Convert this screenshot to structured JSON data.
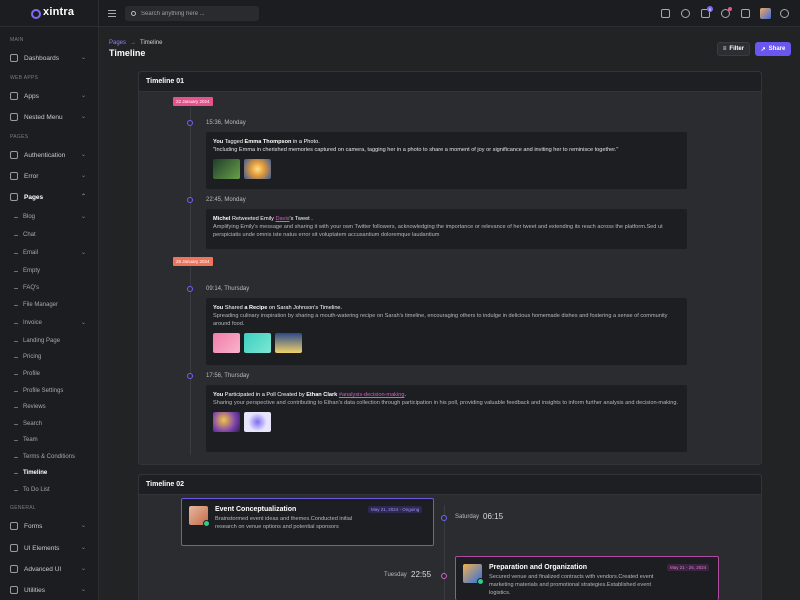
{
  "app": {
    "logo_text": "xintra"
  },
  "header": {
    "search_placeholder": "Search anything here ...",
    "cart_count": "5"
  },
  "sidebar": {
    "sections": {
      "main": "MAIN",
      "web_apps": "WEB APPS",
      "pages": "PAGES",
      "general": "GENERAL"
    },
    "items": {
      "dashboards": "Dashboards",
      "apps": "Apps",
      "nested_menu": "Nested Menu",
      "authentication": "Authentication",
      "error": "Error",
      "pages": "Pages",
      "forms": "Forms",
      "ui_elements": "UI Elements",
      "advanced_ui": "Advanced UI",
      "utilities": "Utilities"
    },
    "sub_items": [
      "Blog",
      "Chat",
      "Email",
      "Empty",
      "FAQ's",
      "File Manager",
      "Invoice",
      "Landing Page",
      "Pricing",
      "Profile",
      "Profile Settings",
      "Reviews",
      "Search",
      "Team",
      "Terms & Conditions",
      "Timeline",
      "To Do List"
    ]
  },
  "page": {
    "breadcrumb_parent": "Pages",
    "breadcrumb_sep": "→",
    "breadcrumb_current": "Timeline",
    "title": "Timeline",
    "filter_label": "Filter",
    "share_label": "Share"
  },
  "timeline1": {
    "title": "Timeline 01",
    "date1": "22 January 2024",
    "date2": "25 January 2024",
    "colors": {
      "date1": "#e7528d",
      "date2": "#f0735c",
      "dot": "#6c63ff"
    },
    "entries": [
      {
        "time": "15:36, Monday",
        "you": "You",
        "verb": " Tagged ",
        "name": "Emma Thompson",
        "rest": " in a Photo.",
        "body": "\"Including Emma in cherished memories captured on camera, tagging her in a photo to share a moment of joy or significance and inviting her to reminisce together.\""
      },
      {
        "time": "22:45, Monday",
        "who": "Michel",
        "verb": " Retweeted Emily ",
        "link": "Davis",
        "rest": "'s Tweet .",
        "body": "Amplifying Emily's message and sharing it with your own Twitter followers, acknowledging the importance or relevance of her tweet and extending its reach across the platform.Sed ut perspiciatis unde omnis iste natus error sit voluptatem accusantium doloremque laudantium"
      },
      {
        "time": "09:14, Thursday",
        "you": "You",
        "verb": " Shared ",
        "name": "a Recipe",
        "rest": " on Sarah Johnson's Timeline.",
        "body": "Spreading culinary inspiration by sharing a mouth-watering recipe on Sarah's timeline, encouraging others to indulge in delicious homemade dishes and fostering a sense of community around food."
      },
      {
        "time": "17:56, Thursday",
        "you": "You",
        "verb": " Participated in a Poll Created by ",
        "name": "Ethan Clark",
        "link": "#analysis-decision-making",
        "rest": ".",
        "body": "Sharing your perspective and contributing to Ethan's data collection through participation in his poll, providing valuable feedback and insights to inform further analysis and decision-making."
      }
    ]
  },
  "timeline2": {
    "title": "Timeline 02",
    "events": [
      {
        "title": "Event Conceptualization",
        "badge": "May 21, 2024 - Ongoing",
        "text": "Brainstormed event ideas and themes.Conducted initial research on venue options and potential sponsors",
        "day": "Saturday",
        "time": "06:15"
      },
      {
        "title": "Preparation and Organization",
        "badge": "May 21 - 26, 2024",
        "text": "Secured venue and finalized contracts with vendors.Created event marketing materials and promotional strategies.Established event logistics.",
        "day": "Tuesday",
        "time": "22:55"
      }
    ]
  }
}
